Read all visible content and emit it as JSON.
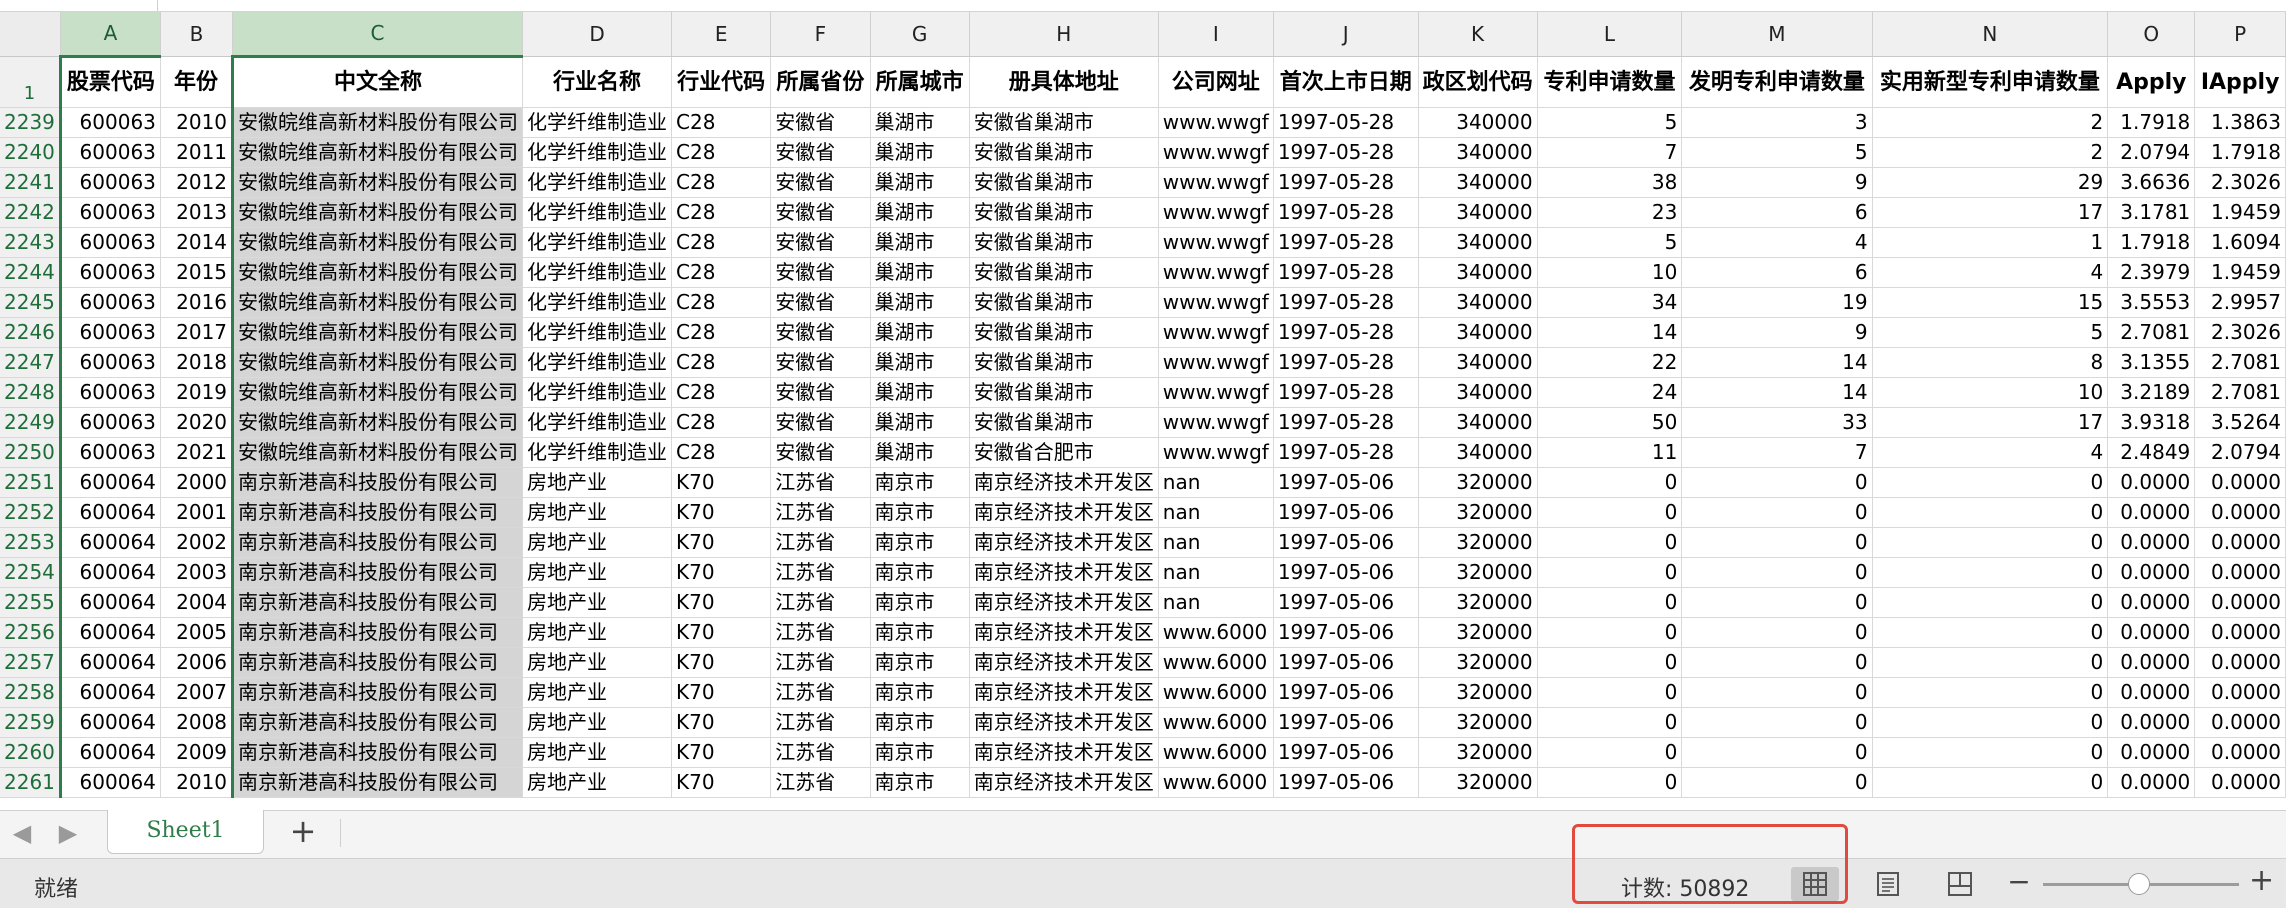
{
  "columns": [
    "A",
    "B",
    "C",
    "D",
    "E",
    "F",
    "G",
    "H",
    "I",
    "J",
    "K",
    "L",
    "M",
    "N",
    "O",
    "P"
  ],
  "header_row_num": "1",
  "headers": [
    "股票代码",
    "年份",
    "中文全称",
    "行业名称",
    "行业代码",
    "所属省份",
    "所属城市",
    "册具体地址",
    "公司网址",
    "首次上市日期",
    "政区划代码",
    "专利申请数量",
    "发明专利申请数量",
    "实用新型专利申请数量",
    "Apply",
    "IApply"
  ],
  "rows": [
    {
      "n": "2239",
      "c": [
        "600063",
        "2010",
        "安徽皖维高新材料股份有限公司",
        "化学纤维制造业",
        "C28",
        "安徽省",
        "巢湖市",
        "安徽省巢湖市",
        "www.wwgf",
        "1997-05-28",
        "340000",
        "5",
        "3",
        "2",
        "1.7918",
        "1.3863"
      ]
    },
    {
      "n": "2240",
      "c": [
        "600063",
        "2011",
        "安徽皖维高新材料股份有限公司",
        "化学纤维制造业",
        "C28",
        "安徽省",
        "巢湖市",
        "安徽省巢湖市",
        "www.wwgf",
        "1997-05-28",
        "340000",
        "7",
        "5",
        "2",
        "2.0794",
        "1.7918"
      ]
    },
    {
      "n": "2241",
      "c": [
        "600063",
        "2012",
        "安徽皖维高新材料股份有限公司",
        "化学纤维制造业",
        "C28",
        "安徽省",
        "巢湖市",
        "安徽省巢湖市",
        "www.wwgf",
        "1997-05-28",
        "340000",
        "38",
        "9",
        "29",
        "3.6636",
        "2.3026"
      ]
    },
    {
      "n": "2242",
      "c": [
        "600063",
        "2013",
        "安徽皖维高新材料股份有限公司",
        "化学纤维制造业",
        "C28",
        "安徽省",
        "巢湖市",
        "安徽省巢湖市",
        "www.wwgf",
        "1997-05-28",
        "340000",
        "23",
        "6",
        "17",
        "3.1781",
        "1.9459"
      ]
    },
    {
      "n": "2243",
      "c": [
        "600063",
        "2014",
        "安徽皖维高新材料股份有限公司",
        "化学纤维制造业",
        "C28",
        "安徽省",
        "巢湖市",
        "安徽省巢湖市",
        "www.wwgf",
        "1997-05-28",
        "340000",
        "5",
        "4",
        "1",
        "1.7918",
        "1.6094"
      ]
    },
    {
      "n": "2244",
      "c": [
        "600063",
        "2015",
        "安徽皖维高新材料股份有限公司",
        "化学纤维制造业",
        "C28",
        "安徽省",
        "巢湖市",
        "安徽省巢湖市",
        "www.wwgf",
        "1997-05-28",
        "340000",
        "10",
        "6",
        "4",
        "2.3979",
        "1.9459"
      ]
    },
    {
      "n": "2245",
      "c": [
        "600063",
        "2016",
        "安徽皖维高新材料股份有限公司",
        "化学纤维制造业",
        "C28",
        "安徽省",
        "巢湖市",
        "安徽省巢湖市",
        "www.wwgf",
        "1997-05-28",
        "340000",
        "34",
        "19",
        "15",
        "3.5553",
        "2.9957"
      ]
    },
    {
      "n": "2246",
      "c": [
        "600063",
        "2017",
        "安徽皖维高新材料股份有限公司",
        "化学纤维制造业",
        "C28",
        "安徽省",
        "巢湖市",
        "安徽省巢湖市",
        "www.wwgf",
        "1997-05-28",
        "340000",
        "14",
        "9",
        "5",
        "2.7081",
        "2.3026"
      ]
    },
    {
      "n": "2247",
      "c": [
        "600063",
        "2018",
        "安徽皖维高新材料股份有限公司",
        "化学纤维制造业",
        "C28",
        "安徽省",
        "巢湖市",
        "安徽省巢湖市",
        "www.wwgf",
        "1997-05-28",
        "340000",
        "22",
        "14",
        "8",
        "3.1355",
        "2.7081"
      ]
    },
    {
      "n": "2248",
      "c": [
        "600063",
        "2019",
        "安徽皖维高新材料股份有限公司",
        "化学纤维制造业",
        "C28",
        "安徽省",
        "巢湖市",
        "安徽省巢湖市",
        "www.wwgf",
        "1997-05-28",
        "340000",
        "24",
        "14",
        "10",
        "3.2189",
        "2.7081"
      ]
    },
    {
      "n": "2249",
      "c": [
        "600063",
        "2020",
        "安徽皖维高新材料股份有限公司",
        "化学纤维制造业",
        "C28",
        "安徽省",
        "巢湖市",
        "安徽省巢湖市",
        "www.wwgf",
        "1997-05-28",
        "340000",
        "50",
        "33",
        "17",
        "3.9318",
        "3.5264"
      ]
    },
    {
      "n": "2250",
      "c": [
        "600063",
        "2021",
        "安徽皖维高新材料股份有限公司",
        "化学纤维制造业",
        "C28",
        "安徽省",
        "巢湖市",
        "安徽省合肥市",
        "www.wwgf",
        "1997-05-28",
        "340000",
        "11",
        "7",
        "4",
        "2.4849",
        "2.0794"
      ]
    },
    {
      "n": "2251",
      "c": [
        "600064",
        "2000",
        "南京新港高科技股份有限公司",
        "房地产业",
        "K70",
        "江苏省",
        "南京市",
        "南京经济技术开发区",
        "nan",
        "1997-05-06",
        "320000",
        "0",
        "0",
        "0",
        "0.0000",
        "0.0000"
      ]
    },
    {
      "n": "2252",
      "c": [
        "600064",
        "2001",
        "南京新港高科技股份有限公司",
        "房地产业",
        "K70",
        "江苏省",
        "南京市",
        "南京经济技术开发区",
        "nan",
        "1997-05-06",
        "320000",
        "0",
        "0",
        "0",
        "0.0000",
        "0.0000"
      ]
    },
    {
      "n": "2253",
      "c": [
        "600064",
        "2002",
        "南京新港高科技股份有限公司",
        "房地产业",
        "K70",
        "江苏省",
        "南京市",
        "南京经济技术开发区",
        "nan",
        "1997-05-06",
        "320000",
        "0",
        "0",
        "0",
        "0.0000",
        "0.0000"
      ]
    },
    {
      "n": "2254",
      "c": [
        "600064",
        "2003",
        "南京新港高科技股份有限公司",
        "房地产业",
        "K70",
        "江苏省",
        "南京市",
        "南京经济技术开发区",
        "nan",
        "1997-05-06",
        "320000",
        "0",
        "0",
        "0",
        "0.0000",
        "0.0000"
      ]
    },
    {
      "n": "2255",
      "c": [
        "600064",
        "2004",
        "南京新港高科技股份有限公司",
        "房地产业",
        "K70",
        "江苏省",
        "南京市",
        "南京经济技术开发区",
        "nan",
        "1997-05-06",
        "320000",
        "0",
        "0",
        "0",
        "0.0000",
        "0.0000"
      ]
    },
    {
      "n": "2256",
      "c": [
        "600064",
        "2005",
        "南京新港高科技股份有限公司",
        "房地产业",
        "K70",
        "江苏省",
        "南京市",
        "南京经济技术开发区",
        "www.6000",
        "1997-05-06",
        "320000",
        "0",
        "0",
        "0",
        "0.0000",
        "0.0000"
      ]
    },
    {
      "n": "2257",
      "c": [
        "600064",
        "2006",
        "南京新港高科技股份有限公司",
        "房地产业",
        "K70",
        "江苏省",
        "南京市",
        "南京经济技术开发区",
        "www.6000",
        "1997-05-06",
        "320000",
        "0",
        "0",
        "0",
        "0.0000",
        "0.0000"
      ]
    },
    {
      "n": "2258",
      "c": [
        "600064",
        "2007",
        "南京新港高科技股份有限公司",
        "房地产业",
        "K70",
        "江苏省",
        "南京市",
        "南京经济技术开发区",
        "www.6000",
        "1997-05-06",
        "320000",
        "0",
        "0",
        "0",
        "0.0000",
        "0.0000"
      ]
    },
    {
      "n": "2259",
      "c": [
        "600064",
        "2008",
        "南京新港高科技股份有限公司",
        "房地产业",
        "K70",
        "江苏省",
        "南京市",
        "南京经济技术开发区",
        "www.6000",
        "1997-05-06",
        "320000",
        "0",
        "0",
        "0",
        "0.0000",
        "0.0000"
      ]
    },
    {
      "n": "2260",
      "c": [
        "600064",
        "2009",
        "南京新港高科技股份有限公司",
        "房地产业",
        "K70",
        "江苏省",
        "南京市",
        "南京经济技术开发区",
        "www.6000",
        "1997-05-06",
        "320000",
        "0",
        "0",
        "0",
        "0.0000",
        "0.0000"
      ]
    },
    {
      "n": "2261",
      "c": [
        "600064",
        "2010",
        "南京新港高科技股份有限公司",
        "房地产业",
        "K70",
        "江苏省",
        "南京市",
        "南京经济技术开发区",
        "www.6000",
        "1997-05-06",
        "320000",
        "0",
        "0",
        "0",
        "0.0000",
        "0.0000"
      ]
    }
  ],
  "sheet_tab": "Sheet1",
  "add_sheet_symbol": "+",
  "nav_prev": "◀",
  "nav_next": "▶",
  "status_ready": "就绪",
  "status_count": "计数: 50892",
  "zoom_minus": "−",
  "zoom_plus": "+",
  "icons": {
    "prev": "chevron-left-icon",
    "next": "chevron-right-icon",
    "normal_view": "grid-icon",
    "page_layout": "page-layout-icon",
    "page_break": "page-break-icon"
  },
  "colors": {
    "accent": "#2f7d4a",
    "highlight": "#e04a3f",
    "selected_fill": "#d5d5d5"
  }
}
